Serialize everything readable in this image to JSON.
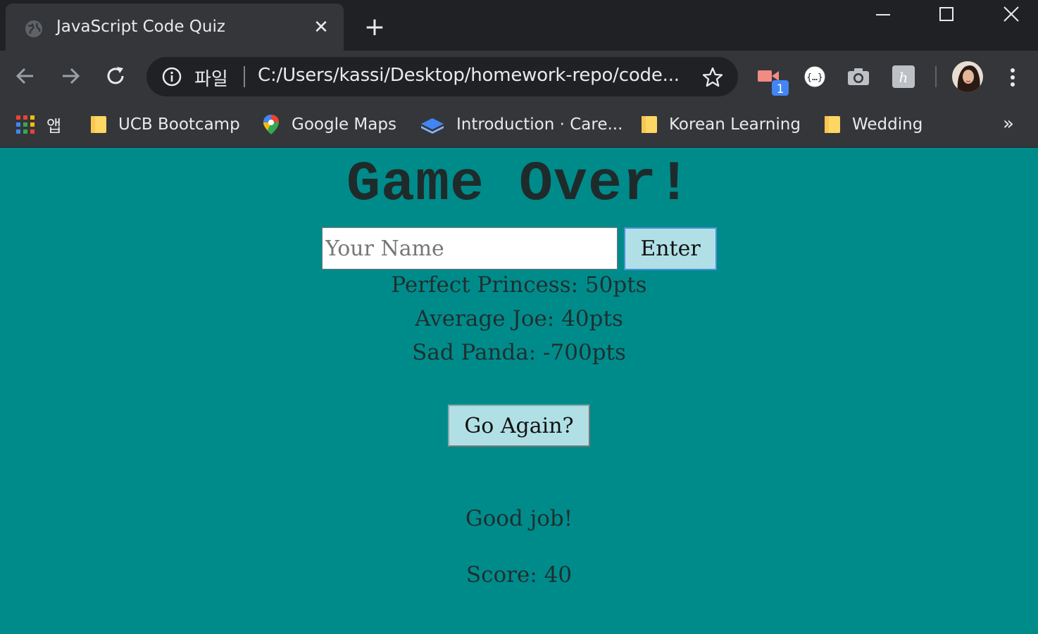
{
  "browser": {
    "tab_title": "JavaScript Code Quiz",
    "file_label": "파일",
    "url": "C:/Users/kassi/Desktop/homework-repo/code...",
    "extension_badge": "1",
    "bookmarks": [
      {
        "label": "앱",
        "icon": "apps-grid-icon"
      },
      {
        "label": "UCB Bootcamp",
        "icon": "folder-icon"
      },
      {
        "label": "Google Maps",
        "icon": "maps-pin-icon"
      },
      {
        "label": "Introduction · Care...",
        "icon": "book-icon"
      },
      {
        "label": "Korean Learning",
        "icon": "folder-icon"
      },
      {
        "label": "Wedding",
        "icon": "folder-icon"
      }
    ],
    "more_bookmarks": "»"
  },
  "quiz": {
    "title": "Game Over!",
    "name_placeholder": "Your Name",
    "name_value": "",
    "enter_label": "Enter",
    "scores": [
      "Perfect Princess: 50pts",
      "Average Joe: 40pts",
      "Sad Panda: -700pts"
    ],
    "again_label": "Go Again?",
    "feedback": "Good job!",
    "score_text": "Score: 40"
  },
  "colors": {
    "page_background": "#008b8b",
    "button_background": "#b0e0e6",
    "chrome_dark": "#202124",
    "chrome_toolbar": "#35363a"
  }
}
